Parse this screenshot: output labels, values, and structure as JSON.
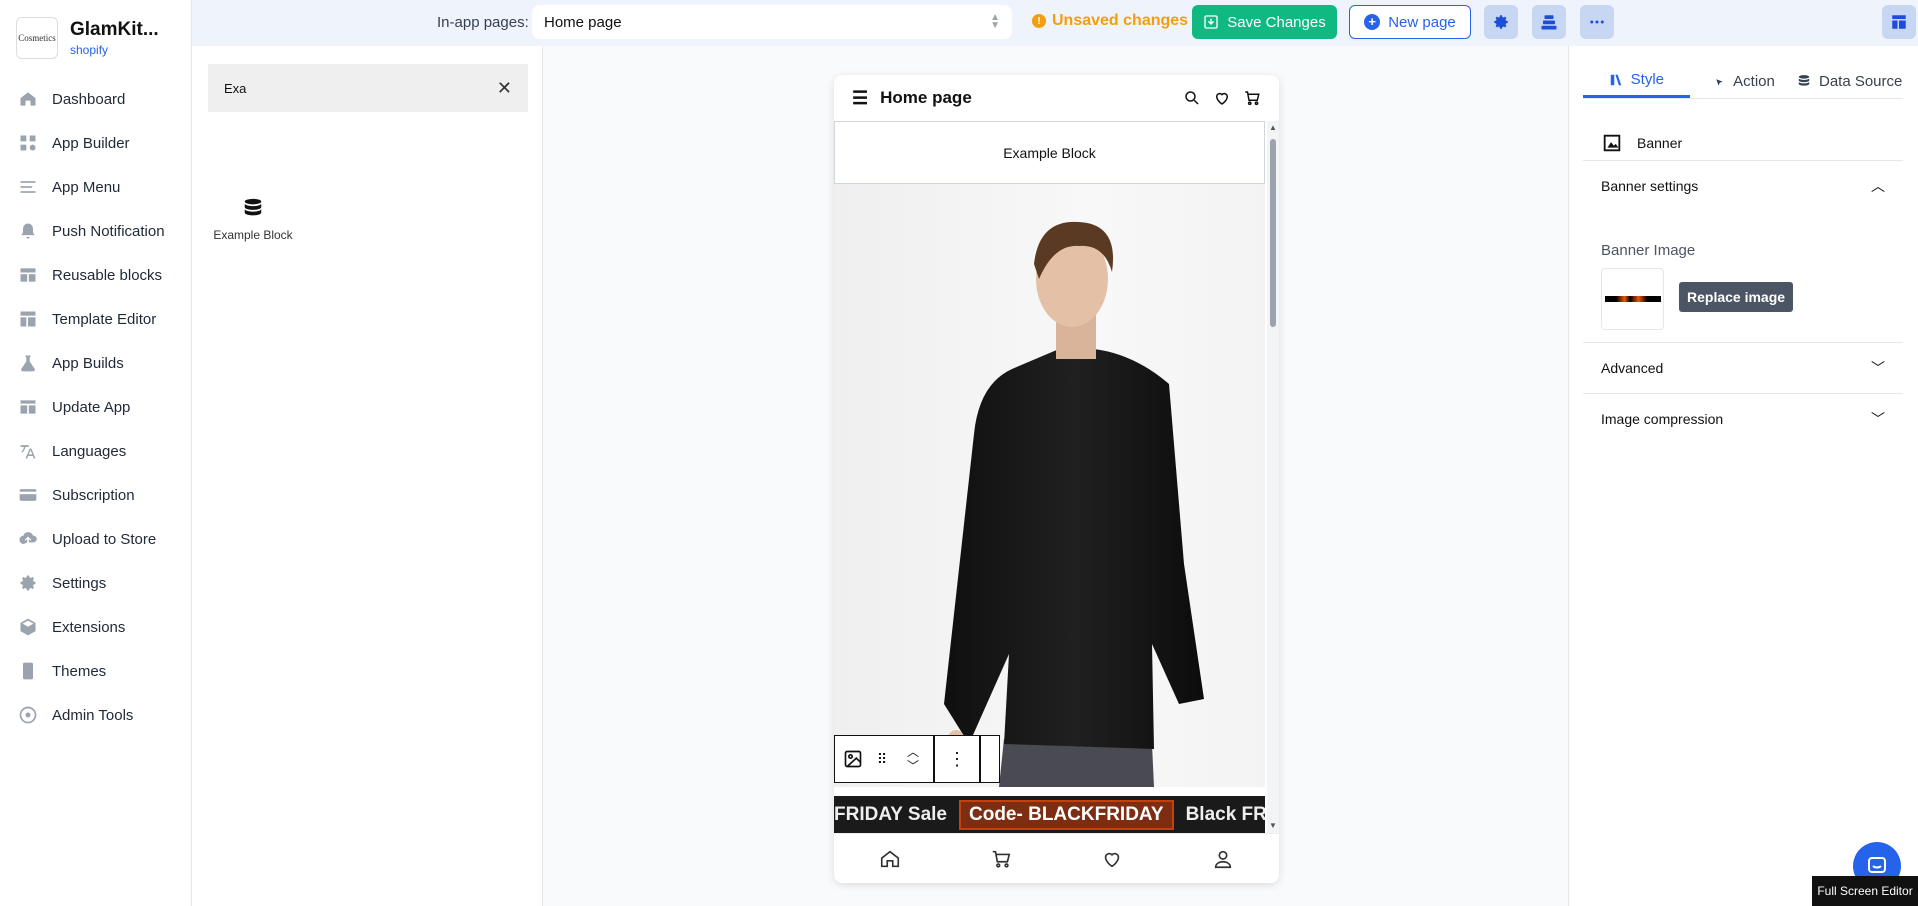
{
  "brand": {
    "logo_text": "Cosmetics",
    "name": "GlamKit...",
    "platform": "shopify"
  },
  "sidebar": {
    "items": [
      {
        "label": "Dashboard",
        "icon": "home-icon"
      },
      {
        "label": "App Builder",
        "icon": "grid-icon"
      },
      {
        "label": "App Menu",
        "icon": "menu-icon"
      },
      {
        "label": "Push Notification",
        "icon": "bell-icon"
      },
      {
        "label": "Reusable blocks",
        "icon": "blocks-icon"
      },
      {
        "label": "Template Editor",
        "icon": "template-icon"
      },
      {
        "label": "App Builds",
        "icon": "flask-icon"
      },
      {
        "label": "Update App",
        "icon": "update-icon"
      },
      {
        "label": "Languages",
        "icon": "translate-icon"
      },
      {
        "label": "Subscription",
        "icon": "card-icon"
      },
      {
        "label": "Upload to Store",
        "icon": "cloud-upload-icon"
      },
      {
        "label": "Settings",
        "icon": "gear-icon"
      },
      {
        "label": "Extensions",
        "icon": "cube-icon"
      },
      {
        "label": "Themes",
        "icon": "phone-icon"
      },
      {
        "label": "Admin Tools",
        "icon": "admin-icon"
      }
    ]
  },
  "topbar": {
    "pages_label": "In-app pages:",
    "pages_value": "Home page",
    "unsaved": "Unsaved changes",
    "save_label": "Save Changes",
    "new_page_label": "New page"
  },
  "blocks_panel": {
    "search_value": "Exa",
    "results": [
      {
        "label": "Example Block",
        "icon": "database-icon"
      }
    ]
  },
  "preview": {
    "header_title": "Home page",
    "example_block": "Example Block",
    "promo_left": "FRIDAY Sale",
    "promo_code": "Code- BLACKFRIDAY",
    "promo_right": "Black FR"
  },
  "props": {
    "tabs": [
      {
        "label": "Style",
        "active": true
      },
      {
        "label": "Action",
        "active": false
      },
      {
        "label": "Data Source",
        "active": false
      }
    ],
    "component_name": "Banner",
    "banner_settings": "Banner settings",
    "banner_image_label": "Banner Image",
    "replace_label": "Replace image",
    "advanced": "Advanced",
    "compression": "Image compression"
  },
  "footer": {
    "fullscreen_label": "Full Screen Editor"
  },
  "colors": {
    "accent": "#2563eb",
    "save": "#10b981",
    "warning": "#f59e0b"
  }
}
